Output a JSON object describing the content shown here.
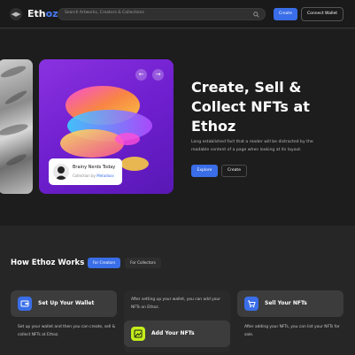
{
  "header": {
    "logo_icon": "chevron-menu-icon",
    "brand": "Eth",
    "brand_accent": "oz.",
    "search_placeholder": "Search Artworks, Creators & Collections",
    "create_label": "Create",
    "connect_label": "Connect Wallet"
  },
  "hero": {
    "title": "Create, Sell & Collect NFTs at Ethoz",
    "description": "Long established fact that a reader will be distracted by the readable content of a page when looking at its layout.",
    "explore_label": "Explore",
    "create_label": "Create",
    "card": {
      "title": "Brainy Nerds Today",
      "by_prefix": "Collection by",
      "by_name": "Metadoxx"
    }
  },
  "how": {
    "title": "How Ethoz Works",
    "tab_active": "For Creators",
    "tab_other": "For Collectors",
    "steps": [
      {
        "name": "Set Up Your Wallet",
        "desc": "Set up your wallet and then you can create, sell & collect NFTs at Ethoz.",
        "icon": "wallet-icon"
      },
      {
        "name": "Add Your NFTs",
        "desc": "After setting up your wallet, you can add your NFTs on Ethoz.",
        "icon": "add-image-icon"
      },
      {
        "name": "Sell Your NFTs",
        "desc": "After adding your NFTs, you can list your NFTs for sale.",
        "icon": "cart-icon"
      }
    ]
  },
  "colors": {
    "accent": "#3a6ee8",
    "lime": "#c3ee1a",
    "card_purple": "#7a25d6"
  }
}
